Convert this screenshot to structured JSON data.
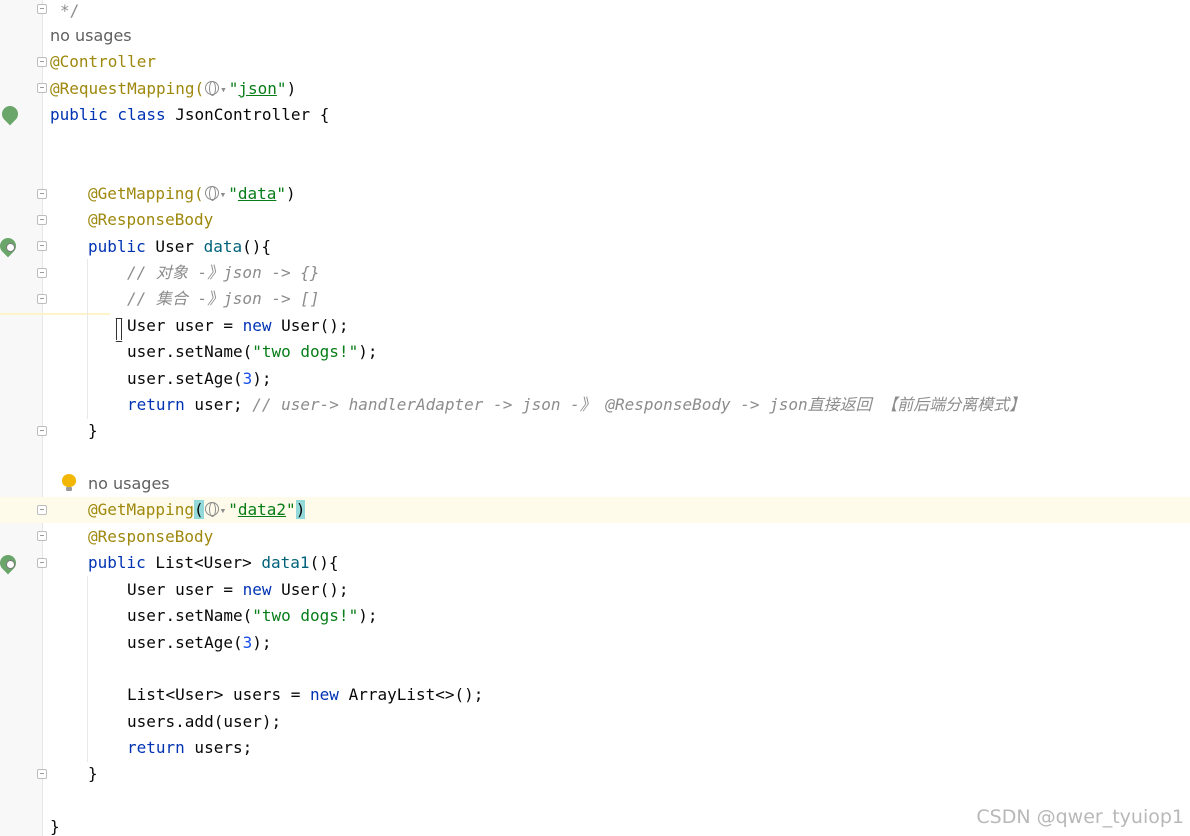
{
  "editor": {
    "usages_label_1": "no usages",
    "usages_label_2": "no usages",
    "line_comment_end": "*/",
    "ann_controller": "@Controller",
    "ann_request_mapping": "@RequestMapping(",
    "request_mapping_path": "json",
    "class_decl_kw": "public class",
    "class_name": " JsonController {",
    "get_mapping_1": "@GetMapping(",
    "get_mapping_1_path": "data",
    "response_body_1": "@ResponseBody",
    "method1_sig_kw": "public",
    "method1_sig_type": " User ",
    "method1_name": "data",
    "method1_rest": "(){",
    "comment_1": "// 对象 -》json -> {}",
    "comment_2": "// 集合 -》json -> []",
    "m1_line1_pre": "User user = ",
    "m1_line1_kw": "new",
    "m1_line1_post": " User();",
    "m1_setname_pre": "user.setName(",
    "m1_setname_str": "\"two dogs!\"",
    "m1_setname_post": ");",
    "m1_setage_pre": "user.setAge(",
    "m1_setage_num": "3",
    "m1_setage_post": ");",
    "m1_return_kw": "return",
    "m1_return_val": " user; ",
    "m1_return_comment": "// user-> handlerAdapter -> json -》 @ResponseBody -> json直接返回 【前后端分离模式】",
    "close_brace_1": "}",
    "get_mapping_2": "@GetMapping",
    "get_mapping_2_open": "(",
    "get_mapping_2_path": "data2",
    "get_mapping_2_close": ")",
    "response_body_2": "@ResponseBody",
    "method2_sig_kw": "public",
    "method2_sig_type": " List<User> ",
    "method2_name": "data1",
    "method2_rest": "(){",
    "m2_line1_pre": "User user = ",
    "m2_line1_kw": "new",
    "m2_line1_post": " User();",
    "m2_setname_pre": "user.setName(",
    "m2_setname_str": "\"two dogs!\"",
    "m2_setname_post": ");",
    "m2_setage_pre": "user.setAge(",
    "m2_setage_num": "3",
    "m2_setage_post": ");",
    "m2_list_pre": "List<User> users = ",
    "m2_list_kw": "new",
    "m2_list_post": " ArrayList<>();",
    "m2_add": "users.add(user);",
    "m2_return_kw": "return",
    "m2_return_val": " users;",
    "close_brace_2": "}",
    "close_brace_class": "}"
  },
  "watermark": "CSDN @qwer_tyuiop1",
  "icons": [
    "fold-icon",
    "spring-bean-icon",
    "web-endpoint-icon",
    "lightbulb-icon",
    "globe-icon",
    "chevron-down-icon"
  ]
}
